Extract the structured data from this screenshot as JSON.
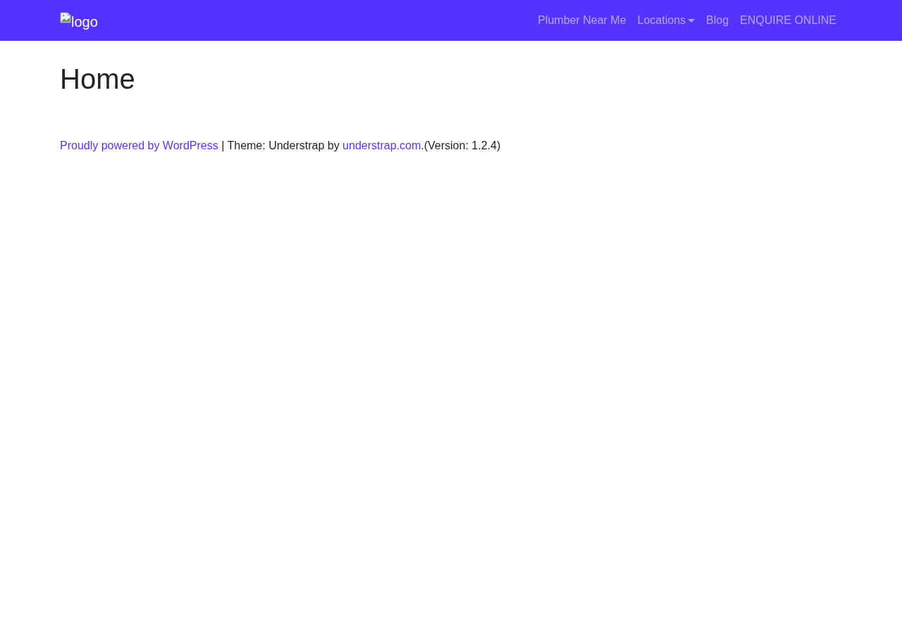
{
  "navbar": {
    "logo": {
      "alt_text": "logo"
    },
    "items": [
      {
        "kind": "link",
        "label": "Plumber Near Me"
      },
      {
        "kind": "dropdown",
        "label": "Locations"
      },
      {
        "kind": "link",
        "label": "Blog"
      },
      {
        "kind": "link",
        "label": "ENQUIRE ONLINE"
      }
    ]
  },
  "page": {
    "title": "Home"
  },
  "footer": {
    "site_info": [
      {
        "kind": "link",
        "text": "Proudly powered by WordPress"
      },
      {
        "kind": "text",
        "text": " | Theme: Understrap by "
      },
      {
        "kind": "link",
        "text": "understrap.com"
      },
      {
        "kind": "text",
        "text": ".(Version: 1.2.4)"
      }
    ]
  }
}
